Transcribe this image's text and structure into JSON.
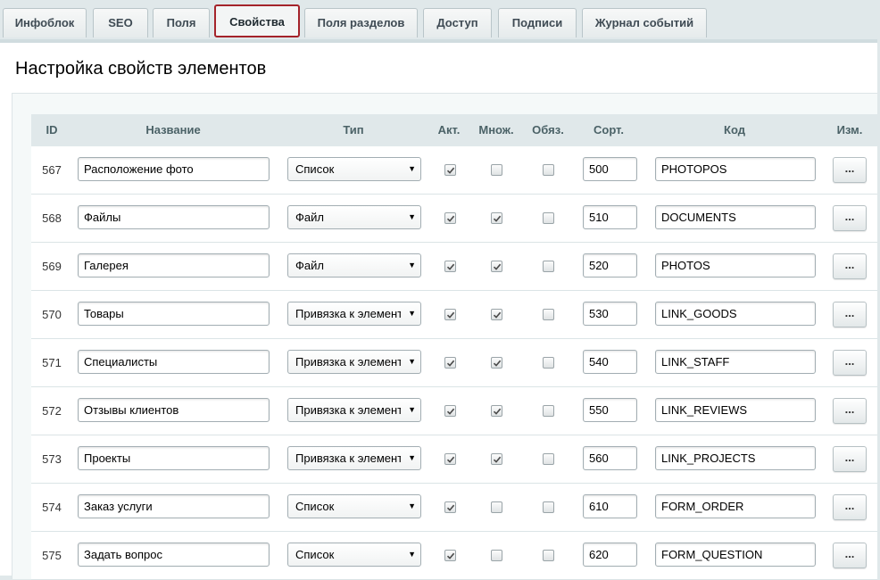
{
  "tabs": [
    {
      "label": "Инфоблок",
      "active": false
    },
    {
      "label": "SEO",
      "active": false
    },
    {
      "label": "Поля",
      "active": false
    },
    {
      "label": "Свойства",
      "active": true
    },
    {
      "label": "Поля разделов",
      "active": false
    },
    {
      "label": "Доступ",
      "active": false
    },
    {
      "label": "Подписи",
      "active": false
    },
    {
      "label": "Журнал событий",
      "active": false
    }
  ],
  "panel": {
    "title": "Настройка свойств элементов"
  },
  "table": {
    "headers": {
      "id": "ID",
      "name": "Название",
      "type": "Тип",
      "active": "Акт.",
      "multiple": "Множ.",
      "required": "Обяз.",
      "sort": "Сорт.",
      "code": "Код",
      "edit": "Изм."
    },
    "edit_button_label": "...",
    "rows": [
      {
        "id": "567",
        "name": "Расположение фото",
        "type": "Список",
        "active": true,
        "multiple": false,
        "required": false,
        "sort": "500",
        "code": "PHOTOPOS"
      },
      {
        "id": "568",
        "name": "Файлы",
        "type": "Файл",
        "active": true,
        "multiple": true,
        "required": false,
        "sort": "510",
        "code": "DOCUMENTS"
      },
      {
        "id": "569",
        "name": "Галерея",
        "type": "Файл",
        "active": true,
        "multiple": true,
        "required": false,
        "sort": "520",
        "code": "PHOTOS"
      },
      {
        "id": "570",
        "name": "Товары",
        "type": "Привязка к элементам",
        "active": true,
        "multiple": true,
        "required": false,
        "sort": "530",
        "code": "LINK_GOODS"
      },
      {
        "id": "571",
        "name": "Специалисты",
        "type": "Привязка к элементам",
        "active": true,
        "multiple": true,
        "required": false,
        "sort": "540",
        "code": "LINK_STAFF"
      },
      {
        "id": "572",
        "name": "Отзывы клиентов",
        "type": "Привязка к элементам",
        "active": true,
        "multiple": true,
        "required": false,
        "sort": "550",
        "code": "LINK_REVIEWS"
      },
      {
        "id": "573",
        "name": "Проекты",
        "type": "Привязка к элементам",
        "active": true,
        "multiple": true,
        "required": false,
        "sort": "560",
        "code": "LINK_PROJECTS"
      },
      {
        "id": "574",
        "name": "Заказ услуги",
        "type": "Список",
        "active": true,
        "multiple": false,
        "required": false,
        "sort": "610",
        "code": "FORM_ORDER"
      },
      {
        "id": "575",
        "name": "Задать вопрос",
        "type": "Список",
        "active": true,
        "multiple": false,
        "required": false,
        "sort": "620",
        "code": "FORM_QUESTION"
      }
    ]
  }
}
